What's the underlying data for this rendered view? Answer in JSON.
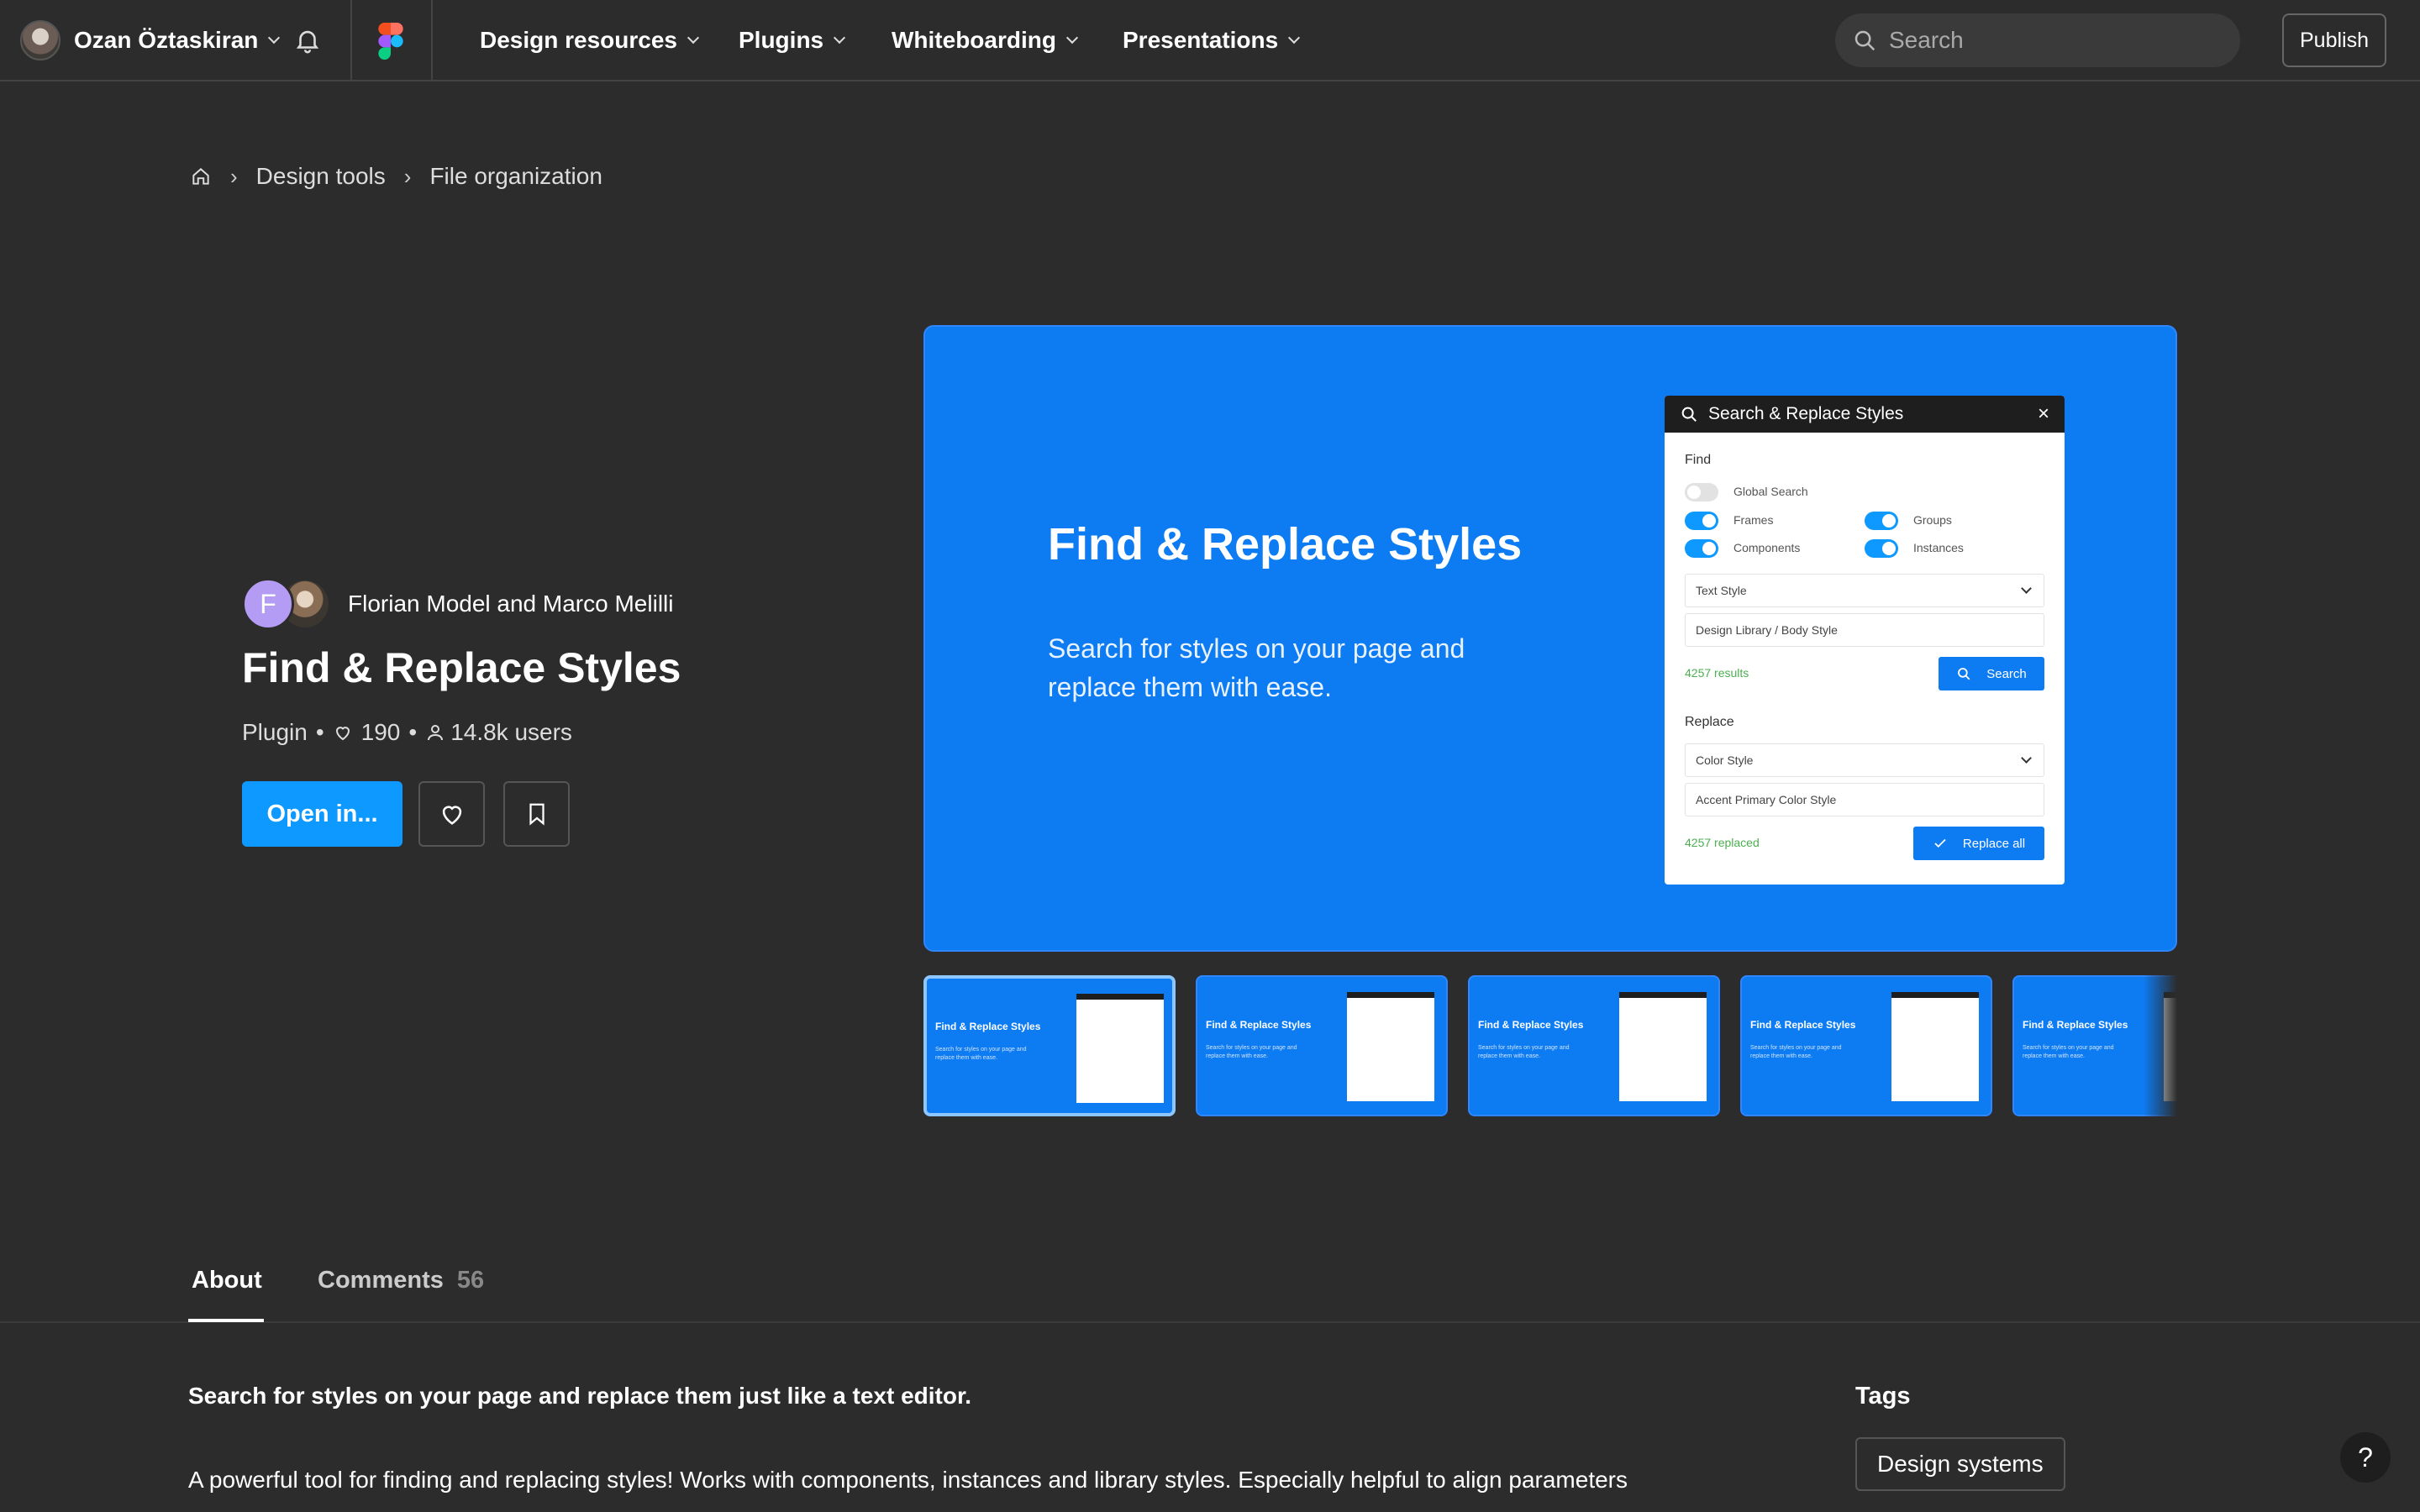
{
  "topnav": {
    "user_name": "Ozan Öztaskiran",
    "menus": [
      "Design resources",
      "Plugins",
      "Whiteboarding",
      "Presentations"
    ],
    "search_placeholder": "Search",
    "publish_label": "Publish"
  },
  "breadcrumb": [
    "Design tools",
    "File organization"
  ],
  "plugin": {
    "author_initial": "F",
    "authors": "Florian Model and Marco Melilli",
    "title": "Find & Replace Styles",
    "type": "Plugin",
    "likes": "190",
    "users": "14.8k users",
    "open_label": "Open in..."
  },
  "hero": {
    "title": "Find & Replace Styles",
    "subtitle": "Search for styles on your page and replace them with ease.",
    "panel": {
      "header": "Search & Replace Styles",
      "find_label": "Find",
      "global_search": "Global Search",
      "frames": "Frames",
      "groups": "Groups",
      "components": "Components",
      "instances": "Instances",
      "find_select": "Text Style",
      "find_value": "Design Library / Body Style",
      "results": "4257 results",
      "search_btn": "Search",
      "replace_label": "Replace",
      "replace_select": "Color Style",
      "replace_value": "Accent Primary Color Style",
      "replaced": "4257 replaced",
      "replace_btn": "Replace all"
    }
  },
  "thumbnails": {
    "title": "Find & Replace Styles",
    "subtitle": "Search for styles on your page and replace them with ease."
  },
  "tabs": {
    "about": "About",
    "comments": "Comments",
    "comments_count": "56"
  },
  "about": {
    "lead": "Search for styles on your page and replace them just like a text editor.",
    "body": "A powerful tool for finding and replacing styles! Works with components, instances and library styles. Especially helpful to align parameters"
  },
  "tags": {
    "heading": "Tags",
    "items": [
      "Design systems"
    ]
  },
  "help_label": "?",
  "colors": {
    "background": "#2c2c2c",
    "accent": "#0d99ff",
    "hero_blue": "#0d7bf2"
  }
}
